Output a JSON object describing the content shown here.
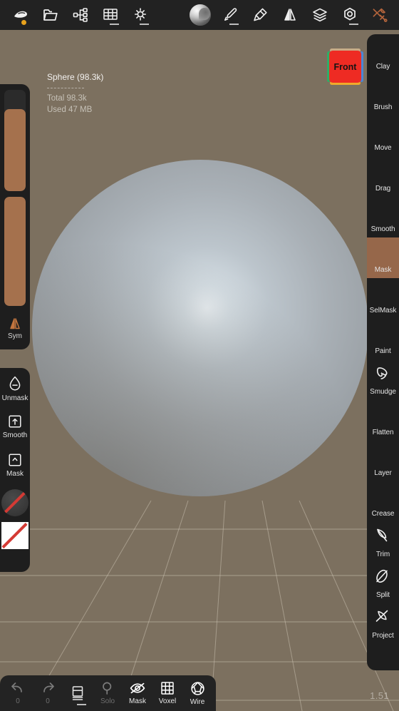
{
  "app": {
    "viewport_bg": "#7c705f",
    "accent": "#a5714d",
    "panel_bg": "#1e1e1e",
    "toolbar_bg": "#222222"
  },
  "topbar": {
    "items": [
      {
        "name": "scene-menu",
        "icon": "cloud-shape-icon",
        "badge": "dot"
      },
      {
        "name": "files",
        "icon": "folder-icon"
      },
      {
        "name": "scene-graph",
        "icon": "node-tree-icon"
      },
      {
        "name": "topology",
        "icon": "grid-icon",
        "badge": "dash"
      },
      {
        "name": "lighting",
        "icon": "sun-icon",
        "badge": "dash"
      },
      {
        "name": "material",
        "icon": "material-ball-icon"
      },
      {
        "name": "stroke",
        "icon": "brush-icon",
        "badge": "dash"
      },
      {
        "name": "paint-fill",
        "icon": "paint-brush-icon"
      },
      {
        "name": "symmetry",
        "icon": "mirror-icon"
      },
      {
        "name": "layers",
        "icon": "layers-icon"
      },
      {
        "name": "settings",
        "icon": "gear-icon",
        "badge": "dash"
      },
      {
        "name": "tools",
        "icon": "wrench-screwdriver-icon"
      }
    ]
  },
  "scene_info": {
    "title": "Sphere (98.3k)",
    "total": "Total 98.3k",
    "used": "Used 47 MB"
  },
  "viewcube": {
    "label": "Front",
    "face_color": "#ee2b23",
    "edge_top": "#c9ab86",
    "edge_bottom": "#f0a92b",
    "edge_left": "#2fae66",
    "edge_right": "#4a86d6"
  },
  "left_sliders": {
    "radius": {
      "name": "radius-slider",
      "value_pct": 81
    },
    "intensity": {
      "name": "intensity-slider",
      "value_pct": 100
    },
    "sym": {
      "label": "Sym",
      "icon": "mirror-icon"
    }
  },
  "left_tools": {
    "items": [
      {
        "label": "Unmask",
        "icon": "droplet-minus-icon"
      },
      {
        "label": "Smooth",
        "icon": "square-up-arrow-icon"
      },
      {
        "label": "Mask",
        "icon": "square-caret-up-icon"
      }
    ],
    "swatches": [
      {
        "name": "alpha-swatch-none",
        "icon": "circle-slash-icon"
      },
      {
        "name": "texture-swatch-none",
        "icon": "square-slash-icon"
      }
    ]
  },
  "right_rail": {
    "active": "Mask",
    "items": [
      {
        "label": "Clay",
        "icon": "clay-ball-icon",
        "ball": "clay"
      },
      {
        "label": "Brush",
        "icon": "brush-ball-icon",
        "ball": "brush"
      },
      {
        "label": "Move",
        "icon": "move-ball-icon",
        "ball": "move"
      },
      {
        "label": "Drag",
        "icon": "drag-ball-icon",
        "ball": "drag"
      },
      {
        "label": "Smooth",
        "icon": "smooth-ball-icon",
        "ball": "smooth"
      },
      {
        "label": "Mask",
        "icon": "mask-ball-icon",
        "ball": "mask"
      },
      {
        "label": "SelMask",
        "icon": "selmask-ball-icon",
        "ball": "selmask"
      },
      {
        "label": "Paint",
        "icon": "paint-ball-icon",
        "ball": "paint"
      },
      {
        "label": "Smudge",
        "icon": "smudge-icon",
        "ball": null
      },
      {
        "label": "Flatten",
        "icon": "flatten-ball-icon",
        "ball": "flatten"
      },
      {
        "label": "Layer",
        "icon": "layer-ball-icon",
        "ball": "layer"
      },
      {
        "label": "Crease",
        "icon": "crease-ball-icon",
        "ball": "crease"
      },
      {
        "label": "Trim",
        "icon": "trim-icon",
        "ball": null
      },
      {
        "label": "Split",
        "icon": "split-icon",
        "ball": null
      },
      {
        "label": "Project",
        "icon": "project-icon",
        "ball": null
      },
      {
        "label": "",
        "icon": "cut-ball-icon",
        "ball": "cut"
      }
    ]
  },
  "bottombar": {
    "items": [
      {
        "label": "0",
        "name": "undo-button",
        "icon": "undo-arrow-icon",
        "dim": true
      },
      {
        "label": "0",
        "name": "redo-button",
        "icon": "redo-arrow-icon",
        "dim": true
      },
      {
        "label": "",
        "name": "layers-button",
        "icon": "book-layers-icon",
        "dim": false
      },
      {
        "label": "Solo",
        "name": "solo-toggle",
        "icon": "magnifier-icon",
        "dim": true
      },
      {
        "label": "Mask",
        "name": "mask-visibility-toggle",
        "icon": "eye-slash-icon",
        "dim": false
      },
      {
        "label": "Voxel",
        "name": "voxel-toggle",
        "icon": "grid-icon",
        "dim": false
      },
      {
        "label": "Wire",
        "name": "wireframe-toggle",
        "icon": "wireframe-sphere-icon",
        "dim": false
      }
    ]
  },
  "status": {
    "fps": "1.51"
  }
}
